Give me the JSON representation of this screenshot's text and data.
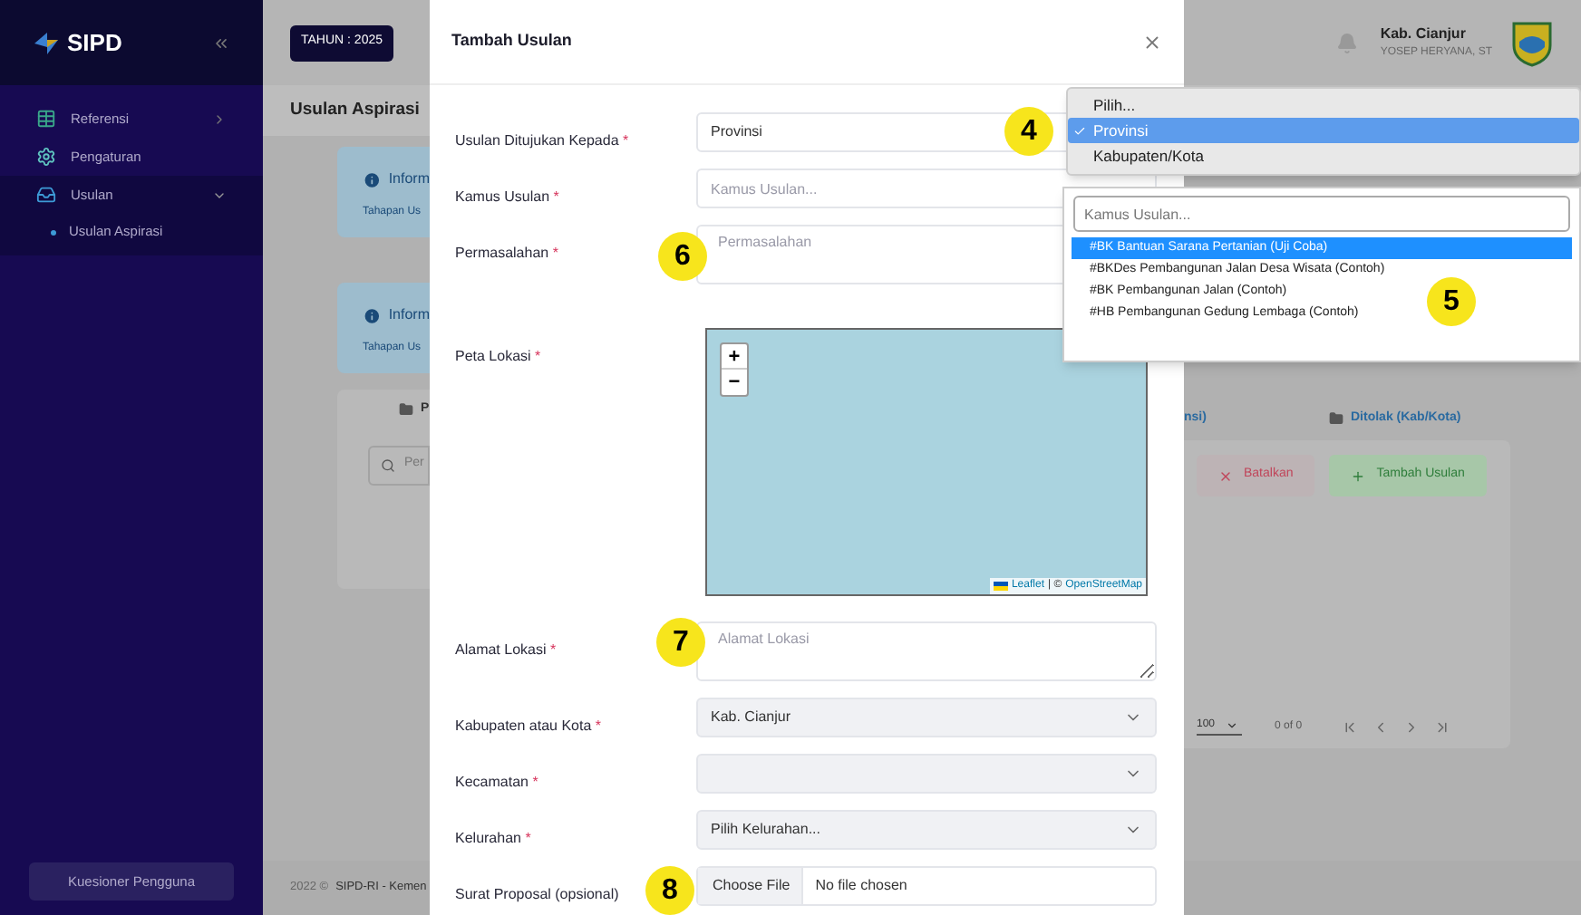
{
  "sidebar": {
    "logo": "SIPD",
    "items": [
      {
        "label": "Referensi",
        "kind": "group",
        "expanded": false
      },
      {
        "label": "Pengaturan",
        "kind": "link"
      },
      {
        "label": "Usulan",
        "kind": "group",
        "expanded": true,
        "children": [
          {
            "label": "Usulan Aspirasi"
          }
        ]
      }
    ],
    "bottom_button": "Kuesioner Pengguna"
  },
  "header": {
    "year_button": "TAHUN : 2025",
    "region": "Kab. Cianjur",
    "user": "YOSEP HERYANA, ST"
  },
  "page_title": "Usulan Aspirasi",
  "left_strip": {
    "info_cards": [
      {
        "title": "Inform",
        "text": "Tahapan Us"
      },
      {
        "title": "Inform",
        "text": "Tahapan Us"
      }
    ],
    "tab": "P",
    "search_placeholder": "Per"
  },
  "right_strip": {
    "tabs": [
      {
        "label": "nsi)",
        "icon": false
      },
      {
        "label": "Ditolak (Kab/Kota)",
        "icon": true
      }
    ],
    "buttons": [
      {
        "label": "Batalkan",
        "kind": "cancel"
      },
      {
        "label": "Tambah Usulan",
        "kind": "add"
      }
    ],
    "page_size": "100",
    "page_info": "0 of 0"
  },
  "footer": {
    "year": "2022 ©",
    "link": "SIPD-RI - Kemen"
  },
  "modal": {
    "title": "Tambah Usulan",
    "fields": [
      {
        "label": "Usulan Ditujukan Kepada",
        "required_mark": "*",
        "kind": "select",
        "value": "Provinsi"
      },
      {
        "label": "Kamus Usulan",
        "required_mark": "*",
        "kind": "input",
        "placeholder": "Kamus Usulan..."
      },
      {
        "label": "Permasalahan",
        "required_mark": "*",
        "kind": "textarea",
        "placeholder": "Permasalahan"
      },
      {
        "label": "Peta Lokasi",
        "required_mark": "*",
        "kind": "map",
        "zoom_in": "+",
        "zoom_out": "−",
        "attribution_link": "Leaflet",
        "attribution_sep": "| ©",
        "attribution_source": "OpenStreetMap"
      },
      {
        "label": "Alamat Lokasi",
        "required_mark": "*",
        "kind": "textarea",
        "placeholder": "Alamat Lokasi"
      },
      {
        "label": "Kabupaten atau Kota",
        "required_mark": "*",
        "kind": "select",
        "value": "Kab. Cianjur"
      },
      {
        "label": "Kecamatan",
        "required_mark": "*",
        "kind": "select"
      },
      {
        "label": "Kelurahan",
        "required_mark": "*",
        "kind": "select",
        "value": "Pilih Kelurahan..."
      },
      {
        "label": "Surat Proposal (opsional)",
        "kind": "file",
        "button": "Choose File",
        "status": "No file chosen"
      }
    ]
  },
  "select_menu": {
    "options": [
      {
        "label": "Pilih...",
        "selected": false
      },
      {
        "label": "Provinsi",
        "selected": true
      },
      {
        "label": "Kabupaten/Kota",
        "selected": false
      }
    ]
  },
  "kamus_menu": {
    "search_placeholder": "Kamus Usulan...",
    "options": [
      {
        "label": "#BK Bantuan Sarana Pertanian (Uji Coba)",
        "selected": true
      },
      {
        "label": "#BKDes Pembangunan Jalan Desa Wisata (Contoh)",
        "selected": false
      },
      {
        "label": "#BK Pembangunan Jalan (Contoh)",
        "selected": false
      },
      {
        "label": "#HB Pembangunan Gedung Lembaga (Contoh)",
        "selected": false
      }
    ]
  },
  "annotations": [
    {
      "number": "4"
    },
    {
      "number": "5"
    },
    {
      "number": "6"
    },
    {
      "number": "7"
    },
    {
      "number": "8"
    }
  ]
}
